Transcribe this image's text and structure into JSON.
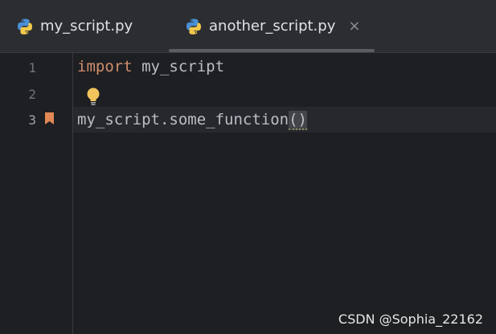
{
  "tabs": [
    {
      "label": "my_script.py",
      "icon": "python-file-icon",
      "active": false
    },
    {
      "label": "another_script.py",
      "icon": "python-file-icon",
      "active": true,
      "closable": true,
      "close_glyph": "×"
    }
  ],
  "gutter": {
    "line_numbers": [
      "1",
      "2",
      "3"
    ],
    "current_line": 3,
    "bookmark_line": 3,
    "intention_bulb_line": 2
  },
  "code": {
    "line1": {
      "keyword": "import",
      "rest": " my_script"
    },
    "line3": {
      "text": "my_script.some_function",
      "paren": "()"
    }
  },
  "watermark": "CSDN @Sophia_22162",
  "colors": {
    "background": "#1e1f22",
    "tabbar": "#2b2d30",
    "keyword": "#cf8e6d",
    "text": "#bcbec4",
    "bookmark": "#e08855",
    "bulb": "#f2c55c"
  }
}
